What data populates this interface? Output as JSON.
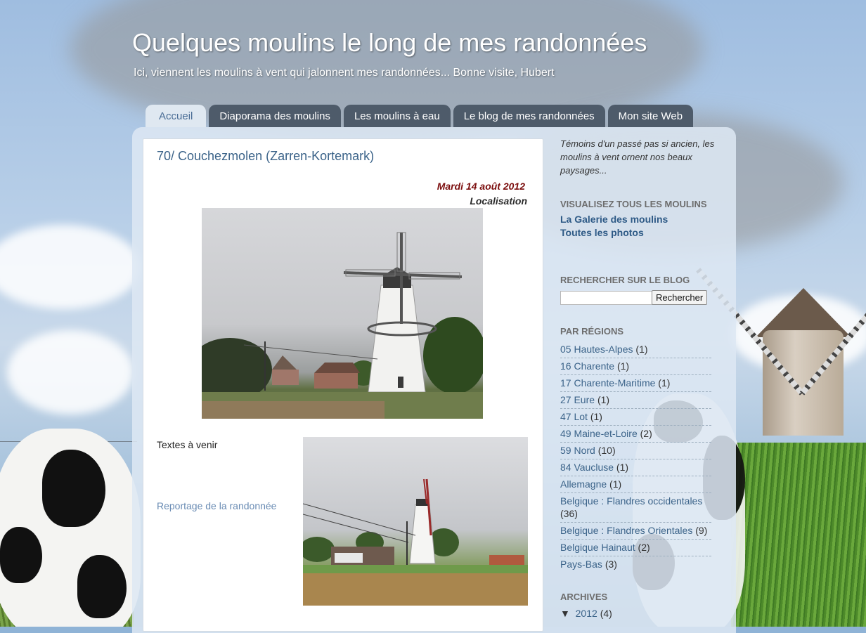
{
  "header": {
    "title": "Quelques moulins le long de mes randonnées",
    "description": "Ici, viennent les moulins à vent qui jalonnent mes randonnées... Bonne visite, Hubert"
  },
  "tabs": [
    {
      "label": "Accueil",
      "active": true
    },
    {
      "label": "Diaporama des moulins",
      "active": false
    },
    {
      "label": "Les moulins à eau",
      "active": false
    },
    {
      "label": "Le blog de mes randonnées",
      "active": false
    },
    {
      "label": "Mon site Web",
      "active": false
    }
  ],
  "post": {
    "title": "70/ Couchezmolen (Zarren-Kortemark)",
    "date": "Mardi 14 août 2012",
    "location_label": "Localisation",
    "text": "Textes à venir",
    "link": "Reportage de la randonnée"
  },
  "sidebar": {
    "intro": "Témoins d'un passé pas si ancien, les moulins à vent ornent nos beaux paysages...",
    "gallery": {
      "heading": "Visualisez tous les moulins",
      "links": [
        "La Galerie des moulins",
        "Toutes les photos"
      ]
    },
    "search": {
      "heading": "Rechercher sur le blog",
      "button": "Rechercher",
      "value": ""
    },
    "regions": {
      "heading": "Par régions",
      "items": [
        {
          "label": "05 Hautes-Alpes",
          "count": "(1)"
        },
        {
          "label": "16 Charente",
          "count": "(1)"
        },
        {
          "label": "17 Charente-Maritime",
          "count": "(1)"
        },
        {
          "label": "27 Eure",
          "count": "(1)"
        },
        {
          "label": "47 Lot",
          "count": "(1)"
        },
        {
          "label": "49 Maine-et-Loire",
          "count": "(2)"
        },
        {
          "label": "59 Nord",
          "count": "(10)"
        },
        {
          "label": "84 Vaucluse",
          "count": "(1)"
        },
        {
          "label": "Allemagne",
          "count": "(1)"
        },
        {
          "label": "Belgique : Flandres occidentales",
          "count": "(36)"
        },
        {
          "label": "Belgique : Flandres Orientales",
          "count": "(9)"
        },
        {
          "label": "Belgique Hainaut",
          "count": "(2)"
        },
        {
          "label": "Pays-Bas",
          "count": "(3)"
        }
      ]
    },
    "archives": {
      "heading": "Archives",
      "toggle": "▼",
      "year": "2012",
      "count": "(4)"
    }
  },
  "colors": {
    "tab_bg": "#4e5b6a",
    "tab_active_bg": "#dfe8f1",
    "link": "#3b6389",
    "date": "#7b0d0d"
  }
}
